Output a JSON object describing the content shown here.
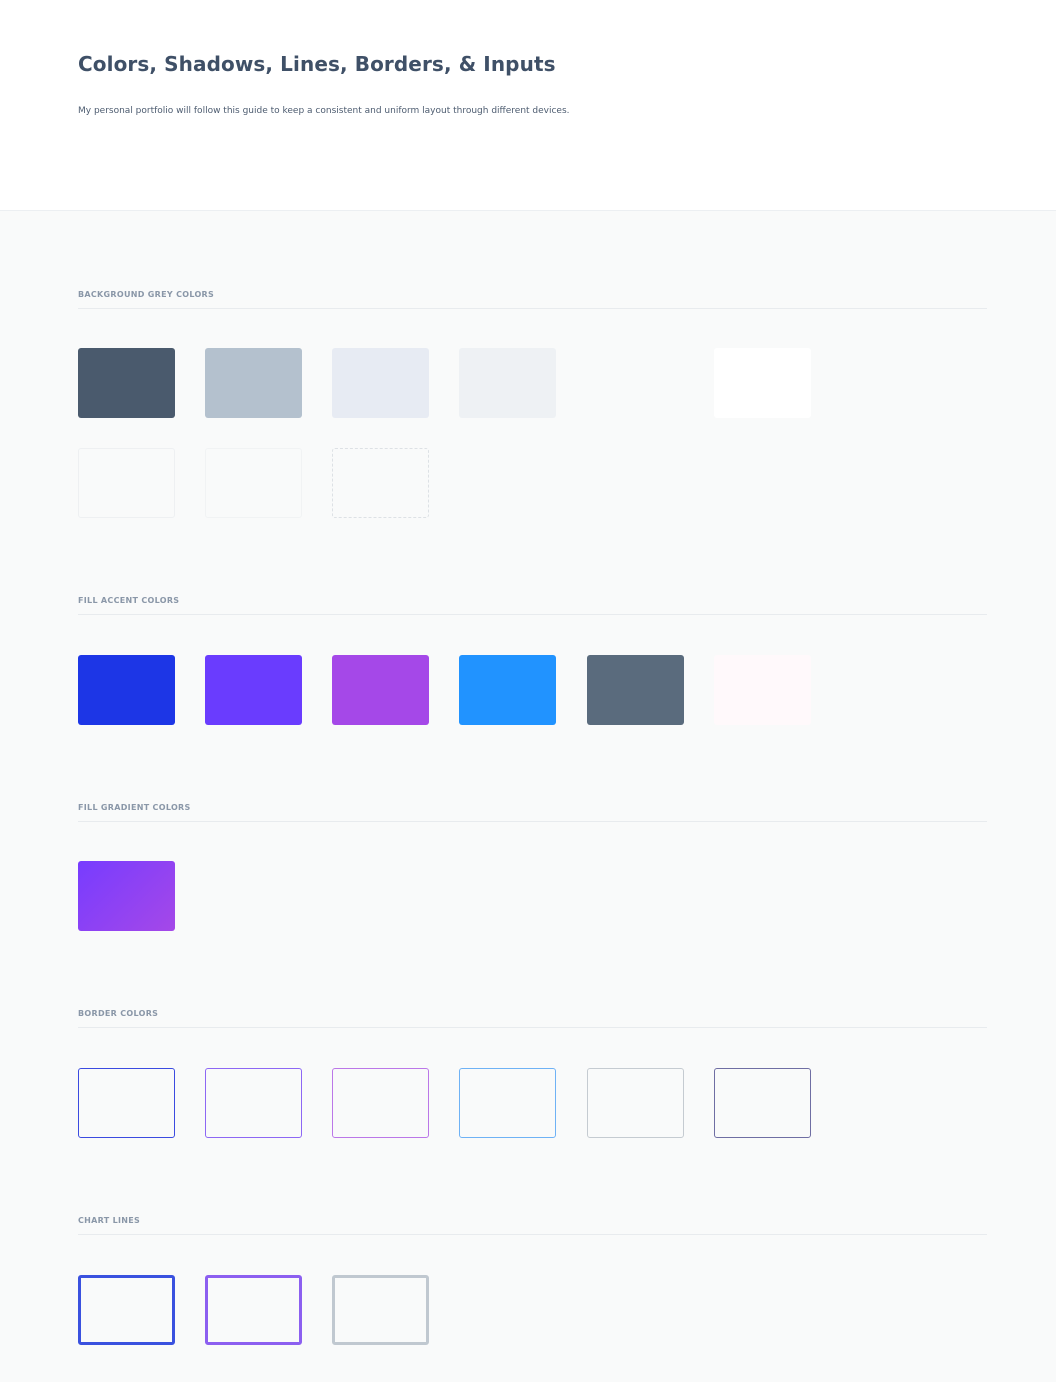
{
  "header": {
    "title": "Colors, Shadows, Lines, Borders, & Inputs",
    "description": "My personal portfolio will follow this guide to keep a consistent and uniform layout through different devices."
  },
  "sections": {
    "background_grey": {
      "label": "BACKGROUND GREY COLORS",
      "row1": [
        "#4a5a6d",
        "#b4c1ce",
        "#e7ebf3",
        "#eef1f4",
        "#ffffff"
      ],
      "row2": [
        "#f9fafa",
        "#f9fafa",
        "#f9fafa"
      ]
    },
    "fill_accent": {
      "label": "FILL ACCENT COLORS",
      "colors": [
        "#1d36e6",
        "#6a3cfe",
        "#a548e8",
        "#2193ff",
        "#5a6b7d",
        "#fff9fb"
      ]
    },
    "fill_gradient": {
      "label": "FILL GRADIENT COLORS",
      "gradient": [
        "#773cff",
        "#a548e8"
      ]
    },
    "border_colors": {
      "label": "BORDER COLORS",
      "colors": [
        "#3b4be0",
        "#8d67f4",
        "#bb77e8",
        "#6fb2f5",
        "#c5cbd1",
        "#6f6ea3"
      ]
    },
    "chart_lines": {
      "label": "CHART LINES",
      "colors": [
        "#3a51df",
        "#8c5ff0",
        "#c0c8d0"
      ]
    }
  }
}
